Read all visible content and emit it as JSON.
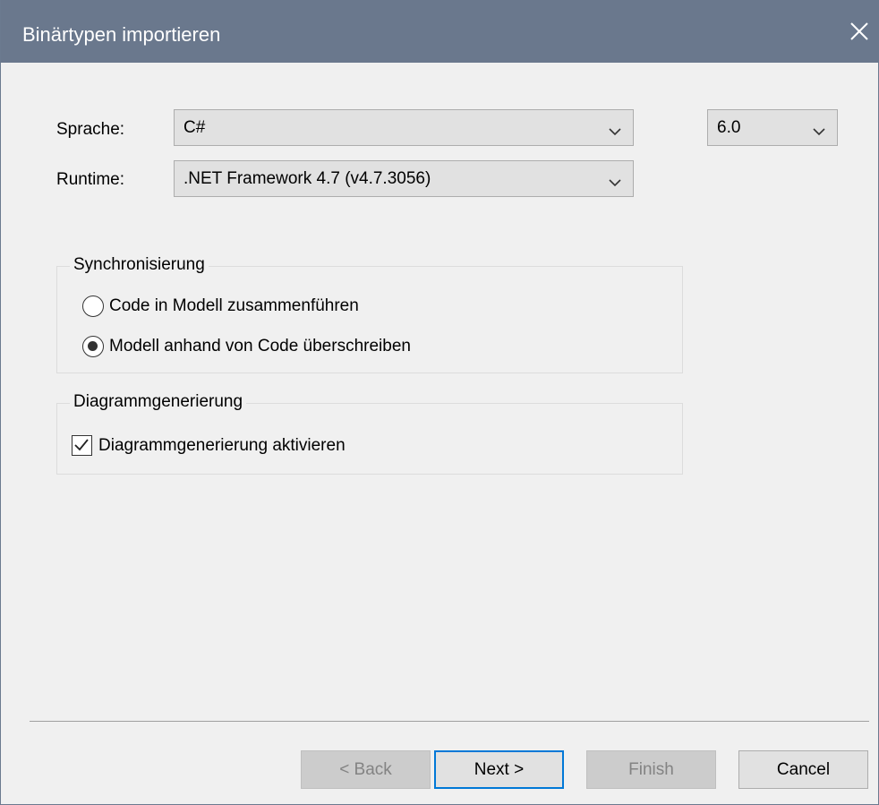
{
  "dialog": {
    "title": "Binärtypen importieren",
    "close_icon": "close-icon"
  },
  "form": {
    "language_label": "Sprache:",
    "language_value": "C#",
    "version_value": "6.0",
    "runtime_label": "Runtime:",
    "runtime_value": ".NET Framework 4.7 (v4.7.3056)"
  },
  "sync_group": {
    "legend": "Synchronisierung",
    "options": [
      {
        "label": "Code in Modell zusammenführen",
        "selected": false
      },
      {
        "label": "Modell anhand von Code überschreiben",
        "selected": true
      }
    ]
  },
  "diagram_group": {
    "legend": "Diagrammgenerierung",
    "checkbox_label": "Diagrammgenerierung aktivieren",
    "checked": true
  },
  "buttons": {
    "back": "< Back",
    "next": "Next >",
    "finish": "Finish",
    "cancel": "Cancel"
  },
  "colors": {
    "titlebar": "#6a788d",
    "focus_accent": "#0078d7"
  }
}
